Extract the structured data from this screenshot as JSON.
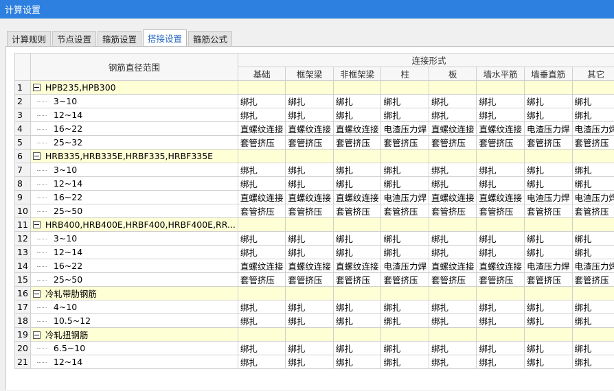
{
  "window": {
    "title": "计算设置"
  },
  "tabs": [
    {
      "label": "计算规则",
      "active": false
    },
    {
      "label": "节点设置",
      "active": false
    },
    {
      "label": "箍筋设置",
      "active": false
    },
    {
      "label": "搭接设置",
      "active": true
    },
    {
      "label": "箍筋公式",
      "active": false
    }
  ],
  "table": {
    "range_header": "钢筋直径范围",
    "group_header": "连接形式",
    "columns": [
      "基础",
      "框架梁",
      "非框架梁",
      "柱",
      "板",
      "墙水平筋",
      "墙垂直筋",
      "其它"
    ],
    "rows": [
      {
        "num": "1",
        "group": true,
        "label": "HPB235,HPB300",
        "cells": [],
        "extra": ""
      },
      {
        "num": "2",
        "group": false,
        "label": "3~10",
        "cells": [
          "绑扎",
          "绑扎",
          "绑扎",
          "绑扎",
          "绑扎",
          "绑扎",
          "绑扎",
          "绑扎"
        ],
        "extra": "1"
      },
      {
        "num": "3",
        "group": false,
        "label": "12~14",
        "cells": [
          "绑扎",
          "绑扎",
          "绑扎",
          "绑扎",
          "绑扎",
          "绑扎",
          "绑扎",
          "绑扎"
        ],
        "extra": "9"
      },
      {
        "num": "4",
        "group": false,
        "label": "16~22",
        "cells": [
          "直螺纹连接",
          "直螺纹连接",
          "直螺纹连接",
          "电渣压力焊",
          "直螺纹连接",
          "直螺纹连接",
          "电渣压力焊",
          "电渣压力焊"
        ],
        "extra": "9"
      },
      {
        "num": "5",
        "group": false,
        "label": "25~32",
        "cells": [
          "套管挤压",
          "套管挤压",
          "套管挤压",
          "套管挤压",
          "套管挤压",
          "套管挤压",
          "套管挤压",
          "套管挤压"
        ],
        "extra": "9"
      },
      {
        "num": "6",
        "group": true,
        "label": "HRB335,HRB335E,HRBF335,HRBF335E",
        "cells": [],
        "extra": ""
      },
      {
        "num": "7",
        "group": false,
        "label": "3~10",
        "cells": [
          "绑扎",
          "绑扎",
          "绑扎",
          "绑扎",
          "绑扎",
          "绑扎",
          "绑扎",
          "绑扎"
        ],
        "extra": "1"
      },
      {
        "num": "8",
        "group": false,
        "label": "12~14",
        "cells": [
          "绑扎",
          "绑扎",
          "绑扎",
          "绑扎",
          "绑扎",
          "绑扎",
          "绑扎",
          "绑扎"
        ],
        "extra": "9"
      },
      {
        "num": "9",
        "group": false,
        "label": "16~22",
        "cells": [
          "直螺纹连接",
          "直螺纹连接",
          "直螺纹连接",
          "电渣压力焊",
          "直螺纹连接",
          "直螺纹连接",
          "电渣压力焊",
          "电渣压力焊"
        ],
        "extra": "9"
      },
      {
        "num": "10",
        "group": false,
        "label": "25~50",
        "cells": [
          "套管挤压",
          "套管挤压",
          "套管挤压",
          "套管挤压",
          "套管挤压",
          "套管挤压",
          "套管挤压",
          "套管挤压"
        ],
        "extra": "9"
      },
      {
        "num": "11",
        "group": true,
        "label": "HRB400,HRB400E,HRBF400,HRBF400E,RR...",
        "cells": [],
        "extra": ""
      },
      {
        "num": "12",
        "group": false,
        "label": "3~10",
        "cells": [
          "绑扎",
          "绑扎",
          "绑扎",
          "绑扎",
          "绑扎",
          "绑扎",
          "绑扎",
          "绑扎"
        ],
        "extra": "1"
      },
      {
        "num": "13",
        "group": false,
        "label": "12~14",
        "cells": [
          "绑扎",
          "绑扎",
          "绑扎",
          "绑扎",
          "绑扎",
          "绑扎",
          "绑扎",
          "绑扎"
        ],
        "extra": "9"
      },
      {
        "num": "14",
        "group": false,
        "label": "16~22",
        "cells": [
          "直螺纹连接",
          "直螺纹连接",
          "直螺纹连接",
          "电渣压力焊",
          "直螺纹连接",
          "直螺纹连接",
          "电渣压力焊",
          "电渣压力焊"
        ],
        "extra": "9"
      },
      {
        "num": "15",
        "group": false,
        "label": "25~50",
        "cells": [
          "套管挤压",
          "套管挤压",
          "套管挤压",
          "套管挤压",
          "套管挤压",
          "套管挤压",
          "套管挤压",
          "套管挤压"
        ],
        "extra": "9"
      },
      {
        "num": "16",
        "group": true,
        "label": "冷轧带肋钢筋",
        "cells": [],
        "extra": ""
      },
      {
        "num": "17",
        "group": false,
        "label": "4~10",
        "cells": [
          "绑扎",
          "绑扎",
          "绑扎",
          "绑扎",
          "绑扎",
          "绑扎",
          "绑扎",
          "绑扎"
        ],
        "extra": "1"
      },
      {
        "num": "18",
        "group": false,
        "label": "10.5~12",
        "cells": [
          "绑扎",
          "绑扎",
          "绑扎",
          "绑扎",
          "绑扎",
          "绑扎",
          "绑扎",
          "绑扎"
        ],
        "extra": "9"
      },
      {
        "num": "19",
        "group": true,
        "label": "冷轧扭钢筋",
        "cells": [],
        "extra": ""
      },
      {
        "num": "20",
        "group": false,
        "label": "6.5~10",
        "cells": [
          "绑扎",
          "绑扎",
          "绑扎",
          "绑扎",
          "绑扎",
          "绑扎",
          "绑扎",
          "绑扎"
        ],
        "extra": "1"
      },
      {
        "num": "21",
        "group": false,
        "label": "12~14",
        "cells": [
          "绑扎",
          "绑扎",
          "绑扎",
          "绑扎",
          "绑扎",
          "绑扎",
          "绑扎",
          "绑扎"
        ],
        "extra": "9"
      }
    ]
  }
}
